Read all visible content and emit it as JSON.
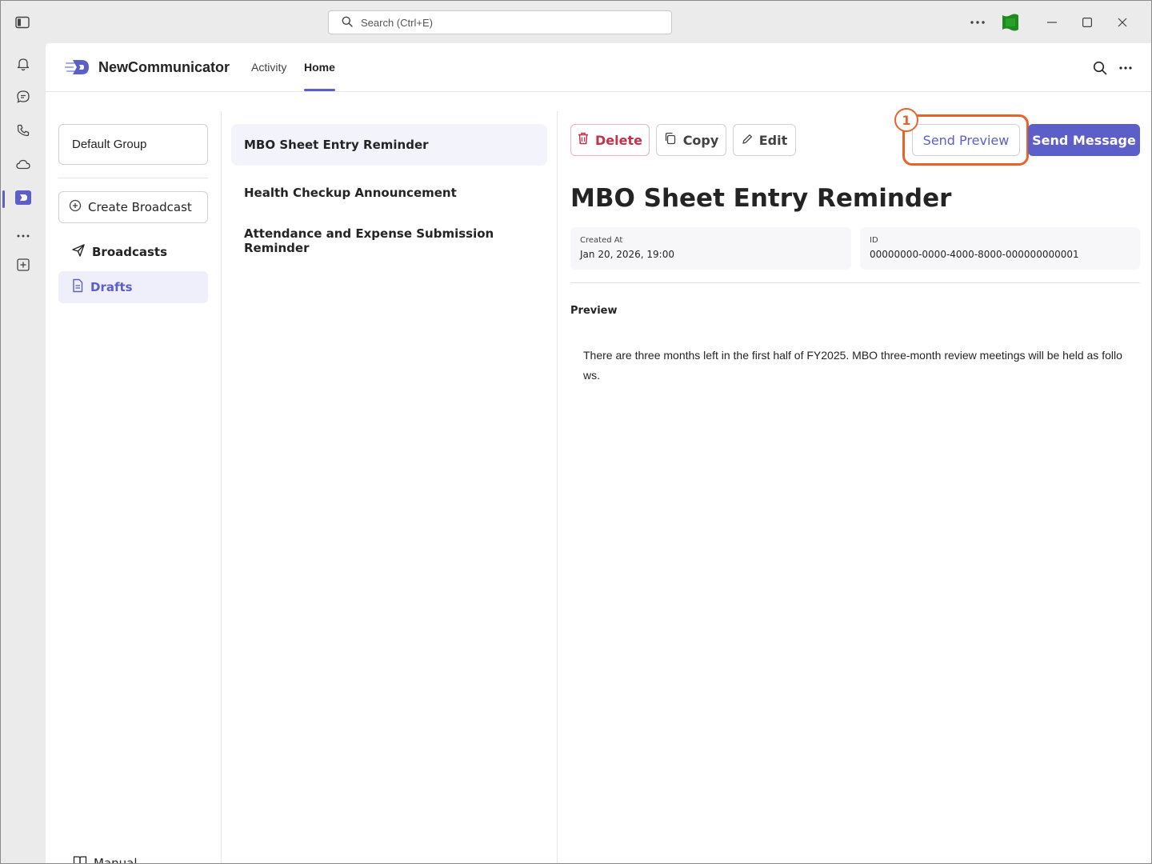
{
  "titlebar": {
    "search_placeholder": "Search (Ctrl+E)"
  },
  "app": {
    "name": "NewCommunicator",
    "tabs": [
      {
        "label": "Activity",
        "active": false
      },
      {
        "label": "Home",
        "active": true
      }
    ]
  },
  "sidebar": {
    "group": "Default Group",
    "create_label": "Create Broadcast",
    "nav": [
      {
        "label": "Broadcasts",
        "active": false
      },
      {
        "label": "Drafts",
        "active": true
      }
    ],
    "manual_label": "Manual"
  },
  "list": {
    "items": [
      {
        "title": "MBO Sheet Entry Reminder",
        "active": true
      },
      {
        "title": "Health Checkup Announcement",
        "active": false
      },
      {
        "title": "Attendance and Expense Submission Reminder",
        "active": false
      }
    ]
  },
  "detail": {
    "actions": {
      "delete": "Delete",
      "copy": "Copy",
      "edit": "Edit",
      "send_preview": "Send Preview",
      "send_message": "Send Message"
    },
    "step_number": "1",
    "title": "MBO Sheet Entry Reminder",
    "meta": {
      "created_label": "Created At",
      "created_value": "Jan 20, 2026, 19:00",
      "id_label": "ID",
      "id_value": "00000000-0000-4000-8000-000000000001"
    },
    "preview_label": "Preview",
    "preview_body": "There are three months left in the first half of FY2025. MBO three-month review meetings will be held as follows."
  },
  "colors": {
    "accent": "#5b5fc7",
    "danger": "#c4314b",
    "highlight": "#e8632b"
  }
}
